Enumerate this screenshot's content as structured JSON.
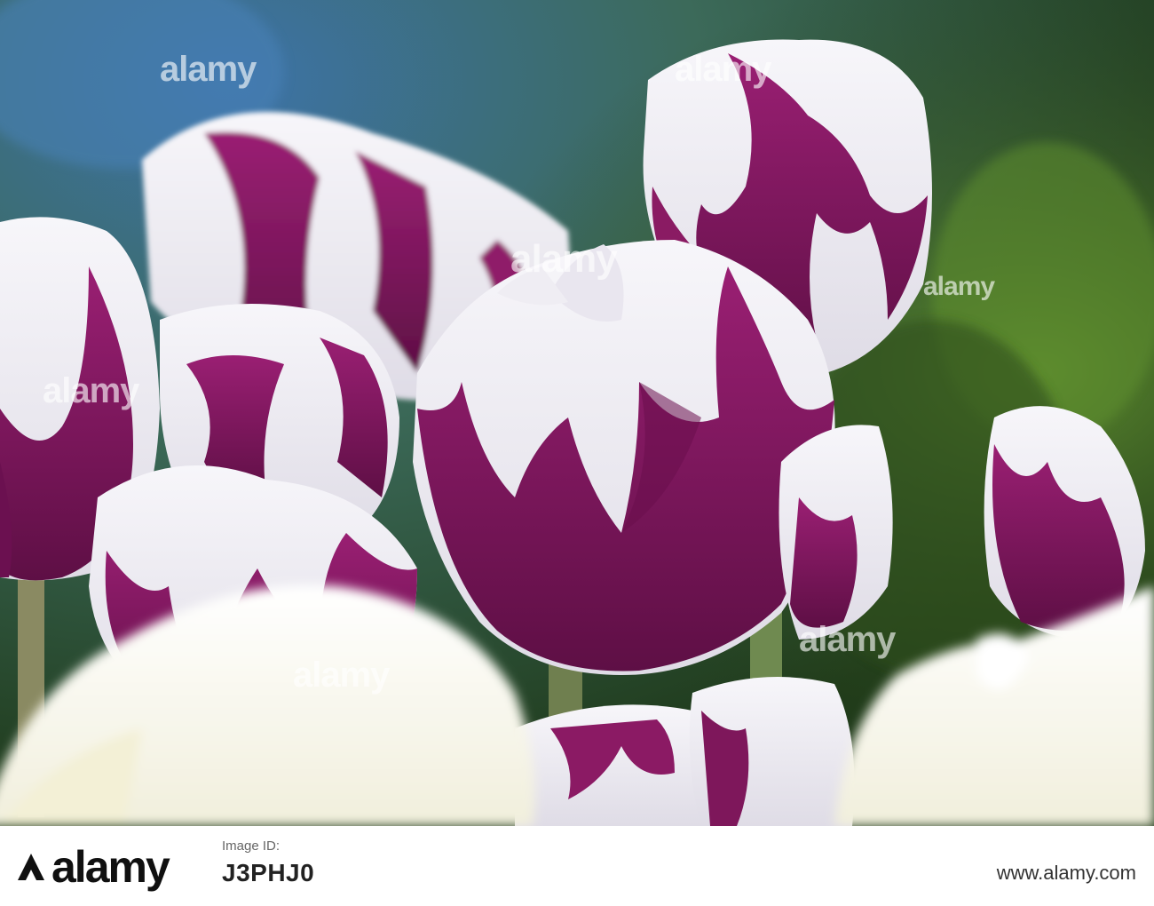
{
  "photo": {
    "subject": "tulips",
    "colors": {
      "petal_white": "#f4f2f6",
      "petal_purple": "#7a1459",
      "background_blue": "#3a6a9a",
      "background_green": "#3f6a24",
      "stem_green": "#7a8a5a"
    }
  },
  "watermark": {
    "text": "alamy",
    "brand_color": "#ffffff"
  },
  "footer": {
    "brand": "alamy",
    "image_id_label": "Image ID:",
    "image_id": "J3PHJ0",
    "url": "www.alamy.com"
  }
}
